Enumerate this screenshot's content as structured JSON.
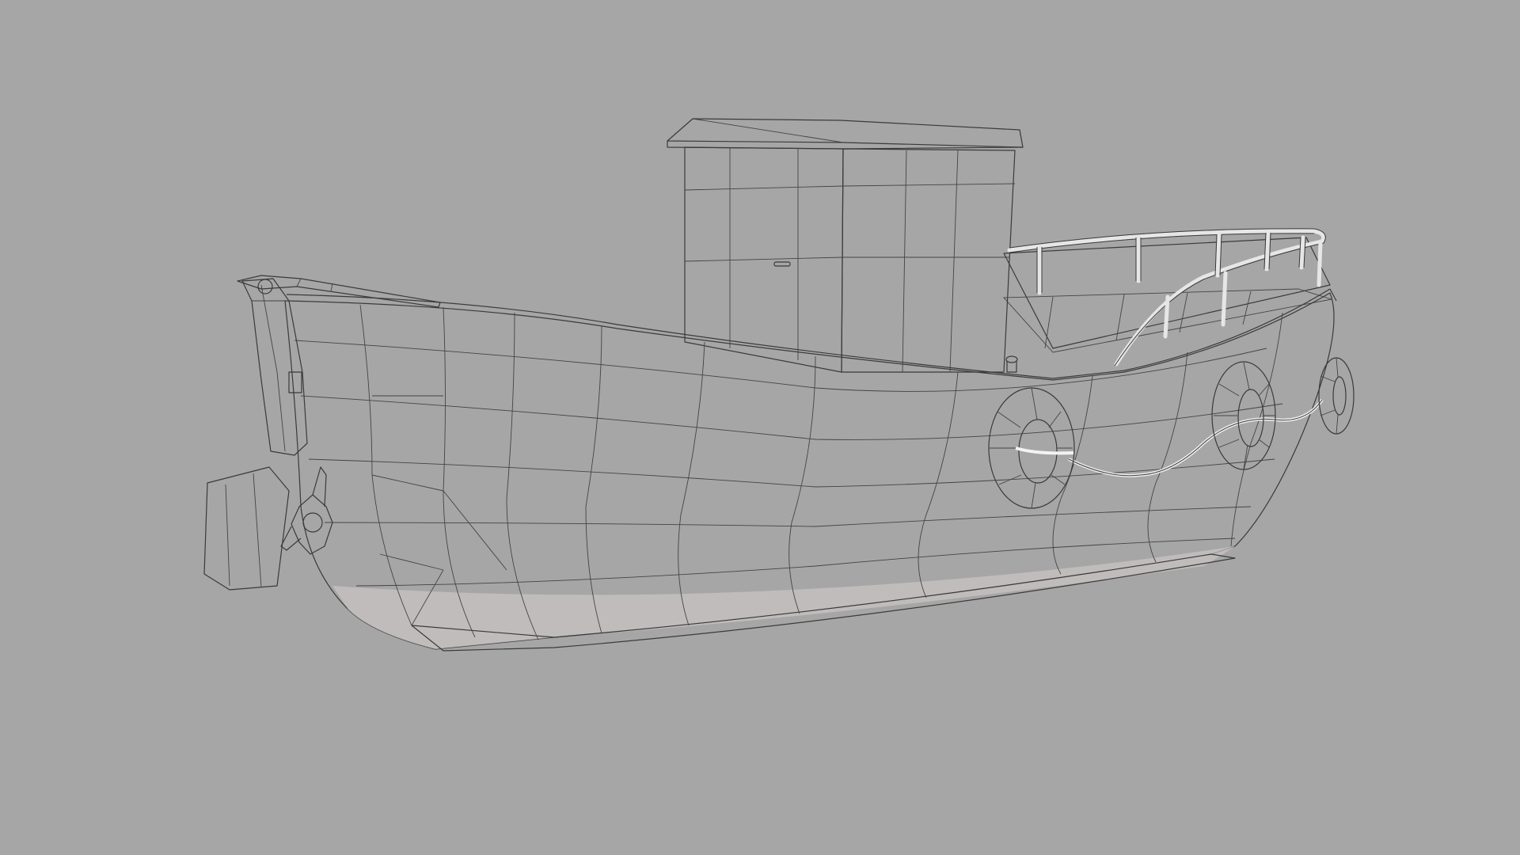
{
  "viewport": {
    "background_color": "#a6a6a6",
    "model_base_color": "#e4e4e4",
    "wireframe_color": "#3a3a3a"
  },
  "model": {
    "subject": "fishing boat",
    "view_mode": "wireframe-on-shaded",
    "parts": [
      "hull",
      "cabin",
      "bow-railing",
      "life-rings",
      "rudder",
      "propeller",
      "boom"
    ],
    "life_ring_count": 3
  }
}
